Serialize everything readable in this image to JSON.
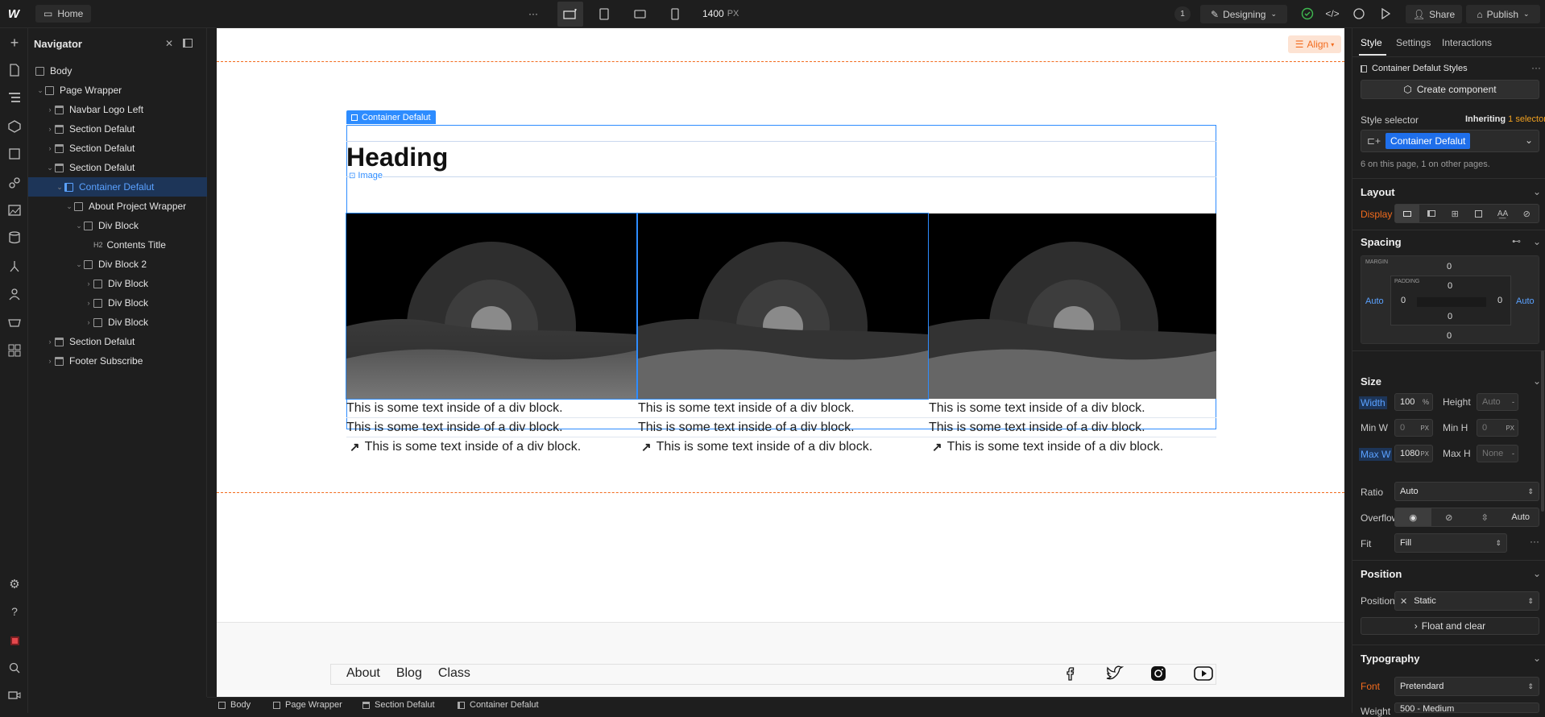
{
  "topbar": {
    "home_label": "Home",
    "more": "···",
    "width_value": "1400",
    "width_unit": "PX",
    "badge": "1",
    "mode": "Designing",
    "share": "Share",
    "publish": "Publish"
  },
  "navigator": {
    "title": "Navigator",
    "items": [
      {
        "label": "Body"
      },
      {
        "label": "Page Wrapper"
      },
      {
        "label": "Navbar Logo Left"
      },
      {
        "label": "Section Defalut"
      },
      {
        "label": "Section Defalut"
      },
      {
        "label": "Section Defalut"
      },
      {
        "label": "Container Defalut"
      },
      {
        "label": "About Project Wrapper"
      },
      {
        "label": "Div Block"
      },
      {
        "label": "Contents Title",
        "tag": "H2"
      },
      {
        "label": "Div Block 2"
      },
      {
        "label": "Div Block"
      },
      {
        "label": "Div Block"
      },
      {
        "label": "Div Block"
      },
      {
        "label": "Section Defalut"
      },
      {
        "label": "Footer Subscribe"
      }
    ]
  },
  "canvas": {
    "align_label": "Align",
    "selected_label": "Container Defalut",
    "heading": "Heading",
    "image_label": "Image",
    "card_text": "This is some text inside of a div block.",
    "footer_links": [
      "About",
      "Blog",
      "Class"
    ],
    "social_icons": [
      "facebook-icon",
      "twitter-icon",
      "instagram-icon",
      "youtube-icon"
    ]
  },
  "style_panel": {
    "tabs": [
      "Style",
      "Settings",
      "Interactions"
    ],
    "header": "Container Defalut Styles",
    "create_component": "Create component",
    "style_selector": "Style selector",
    "inheriting": "Inheriting",
    "selector_count": "1 selector",
    "selector_chip": "Container Defalut",
    "usage": "6 on this page, 1 on other pages.",
    "layout": "Layout",
    "display": "Display",
    "spacing": "Spacing",
    "margin_label": "MARGIN",
    "padding_label": "PADDING",
    "margin_top": "0",
    "margin_bottom": "0",
    "margin_left": "Auto",
    "margin_right": "Auto",
    "padding_top": "0",
    "padding_bottom": "0",
    "padding_left": "0",
    "padding_right": "0",
    "size": "Size",
    "width_label": "Width",
    "width_value": "100",
    "width_unit": "%",
    "height_label": "Height",
    "height_value": "Auto",
    "minw_label": "Min W",
    "minw_value": "0",
    "minh_label": "Min H",
    "minh_value": "0",
    "maxw_label": "Max W",
    "maxw_value": "1080",
    "maxh_label": "Max H",
    "maxh_value": "None",
    "px": "PX",
    "ratio_label": "Ratio",
    "ratio_value": "Auto",
    "overflow_label": "Overflow",
    "overflow_auto": "Auto",
    "fit_label": "Fit",
    "fit_value": "Fill",
    "position": "Position",
    "position_label": "Position",
    "position_value": "Static",
    "float_clear": "Float and clear",
    "typography": "Typography",
    "font_label": "Font",
    "font_value": "Pretendard",
    "weight_label": "Weight",
    "weight_value": "500 - Medium"
  },
  "breadcrumb": [
    "Body",
    "Page Wrapper",
    "Section Defalut",
    "Container Defalut"
  ],
  "colors": {
    "accent": "#1f6feb",
    "selection": "#2d8cff",
    "orange": "#f26b1d",
    "green": "#3fb950"
  }
}
